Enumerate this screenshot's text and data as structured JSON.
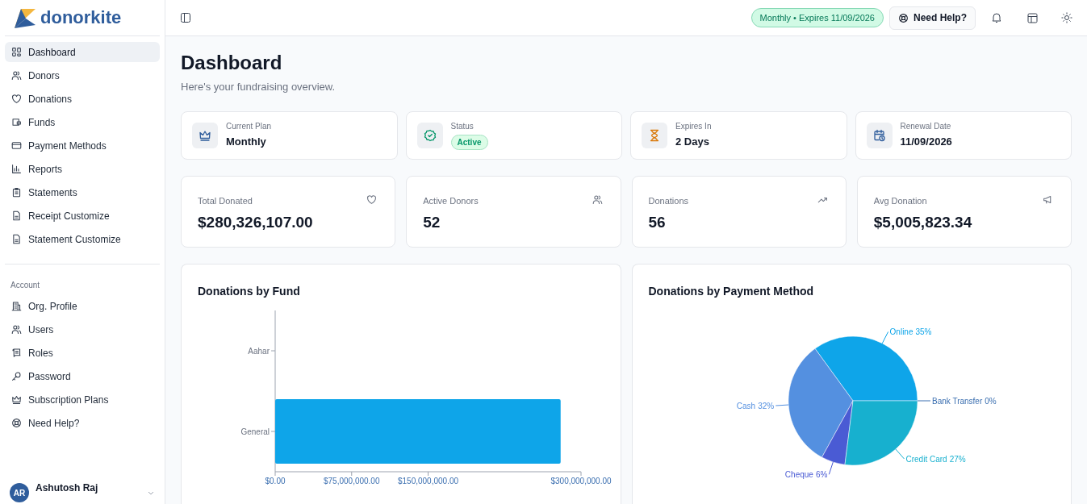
{
  "brand": {
    "name": "donorkite"
  },
  "nav": [
    {
      "label": "Dashboard",
      "selected": true
    },
    {
      "label": "Donors",
      "selected": false
    },
    {
      "label": "Donations",
      "selected": false
    },
    {
      "label": "Funds",
      "selected": false
    },
    {
      "label": "Payment Methods",
      "selected": false
    },
    {
      "label": "Reports",
      "selected": false
    },
    {
      "label": "Statements",
      "selected": false
    },
    {
      "label": "Receipt Customize",
      "selected": false
    },
    {
      "label": "Statement Customize",
      "selected": false
    }
  ],
  "account_nav": {
    "heading": "Account",
    "items": [
      {
        "label": "Org. Profile",
        "selected": false
      },
      {
        "label": "Users",
        "selected": false
      },
      {
        "label": "Roles",
        "selected": false
      },
      {
        "label": "Password",
        "selected": false
      },
      {
        "label": "Subscription Plans",
        "selected": false
      },
      {
        "label": "Need Help?",
        "selected": false
      }
    ]
  },
  "user": {
    "initials": "AR",
    "name": "Ashutosh Raj"
  },
  "header": {
    "plan_badge": "Monthly • Expires 11/09/2026",
    "help_button": "Need Help?"
  },
  "page": {
    "title": "Dashboard",
    "subtitle": "Here's your fundraising overview."
  },
  "plan_cards": [
    {
      "label": "Current Plan",
      "value": "Monthly",
      "kind": "text"
    },
    {
      "label": "Status",
      "value": "Active",
      "kind": "pill"
    },
    {
      "label": "Expires In",
      "value": "2 Days",
      "kind": "text"
    },
    {
      "label": "Renewal Date",
      "value": "11/09/2026",
      "kind": "text"
    }
  ],
  "stats": [
    {
      "label": "Total Donated",
      "value": "$280,326,107.00"
    },
    {
      "label": "Active Donors",
      "value": "52"
    },
    {
      "label": "Donations",
      "value": "56"
    },
    {
      "label": "Avg Donation",
      "value": "$5,005,823.34"
    }
  ],
  "fund_chart": {
    "title": "Donations by Fund",
    "chart_data": {
      "type": "bar",
      "orientation": "horizontal",
      "categories": [
        "Aahar",
        "General"
      ],
      "series": [
        {
          "color": "#0ea5e9",
          "values": [
            0,
            280000000
          ]
        }
      ],
      "xlim": [
        0,
        300000000
      ],
      "xticks": [
        {
          "value": 0,
          "label": "$0.00"
        },
        {
          "value": 75000000,
          "label": "$75,000,000.00"
        },
        {
          "value": 150000000,
          "label": "$150,000,000.00"
        },
        {
          "value": 300000000,
          "label": "$300,000,000.00"
        }
      ]
    }
  },
  "method_chart": {
    "title": "Donations by Payment Method",
    "chart_data": {
      "type": "pie",
      "categories": [
        "Online",
        "Cash",
        "Cheque",
        "Credit Card",
        "Bank Transfer"
      ],
      "series": [
        {
          "values": [
            35,
            32,
            6,
            27,
            0
          ]
        }
      ],
      "value_labels": [
        "35%",
        "32%",
        "6%",
        "27%",
        "0%"
      ]
    }
  }
}
